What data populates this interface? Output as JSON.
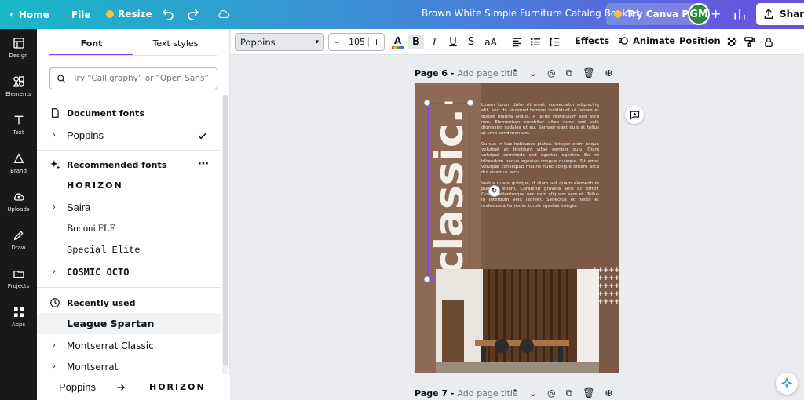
{
  "topbar": {
    "home": "Home",
    "file": "File",
    "resize": "Resize",
    "doc_title": "Brown White Simple Furniture Catalog Booklet",
    "try_pro": "Try Canva Pro",
    "avatar_initials": "GM",
    "share": "Share"
  },
  "rail": [
    {
      "label": "Design",
      "icon": "layout-icon"
    },
    {
      "label": "Elements",
      "icon": "shapes-icon"
    },
    {
      "label": "Text",
      "icon": "text-icon"
    },
    {
      "label": "Brand",
      "icon": "brand-icon"
    },
    {
      "label": "Uploads",
      "icon": "cloud-upload-icon"
    },
    {
      "label": "Draw",
      "icon": "pen-icon"
    },
    {
      "label": "Projects",
      "icon": "folder-icon"
    },
    {
      "label": "Apps",
      "icon": "apps-icon"
    }
  ],
  "panel": {
    "tabs": [
      "Font",
      "Text styles"
    ],
    "active_tab": "Font",
    "search_placeholder": "Try “Calligraphy” or “Open Sans”",
    "document_fonts_label": "Document fonts",
    "document_fonts": [
      "Poppins"
    ],
    "recommended_label": "Recommended fonts",
    "recommended": [
      "HORIZON",
      "Saira",
      "Bodoni FLF",
      "Special Elite",
      "COSMIC OCTO"
    ],
    "recent_label": "Recently used",
    "recent": [
      "League Spartan",
      "Montserrat Classic",
      "Montserrat"
    ],
    "footer_left": "Poppins",
    "footer_right": "HORIZON"
  },
  "toolbar": {
    "font": "Poppins",
    "size": "105",
    "minus": "–",
    "plus": "+",
    "effects": "Effects",
    "animate": "Animate",
    "position": "Position",
    "text_color_bar": "#e2282a"
  },
  "pages": [
    {
      "label": "Page 6 -",
      "title_placeholder": "Add page title"
    },
    {
      "label": "Page 7 -",
      "title_placeholder": "Add page title"
    }
  ],
  "page6": {
    "vertical_heading": "classic.",
    "paragraphs": [
      "Lorem ipsum dolor sit amet, consectetur adipiscing elit, sed do eiusmod tempor incididunt ut labore et dolore magna aliqua. A lacus vestibulum sed arcu non. Elementum curabitur vitae nunc sed velit dignissim sodales ut eu. Semper eget duis at tellus at urna condimentum.",
      "Cursus in hac habitasse platea. Integer enim neque volutpat ac tincidunt vitae semper quis. Diam volutpat commodo sed egestas egestas. Eu mi bibendum neque egestas congue quisque. Sit amet volutpat consequat mauris nunc congue ornare arcu dui vivamus arcu.",
      "Varius quam quisque id diam vel quam elementum pulvinar etiam. Curabitur gravida arcu ac tortor. Quam pellentesque nec nam aliquam sem et. Tellus id interdum velit laoreet. Senectus et netus et malesuada fames ac turpis egestas integer."
    ],
    "background_color": "#7a5a47",
    "strip_color": "#8c6a56"
  },
  "colors": {
    "accent": "#8b3dff",
    "rail_bg": "#18191b"
  }
}
